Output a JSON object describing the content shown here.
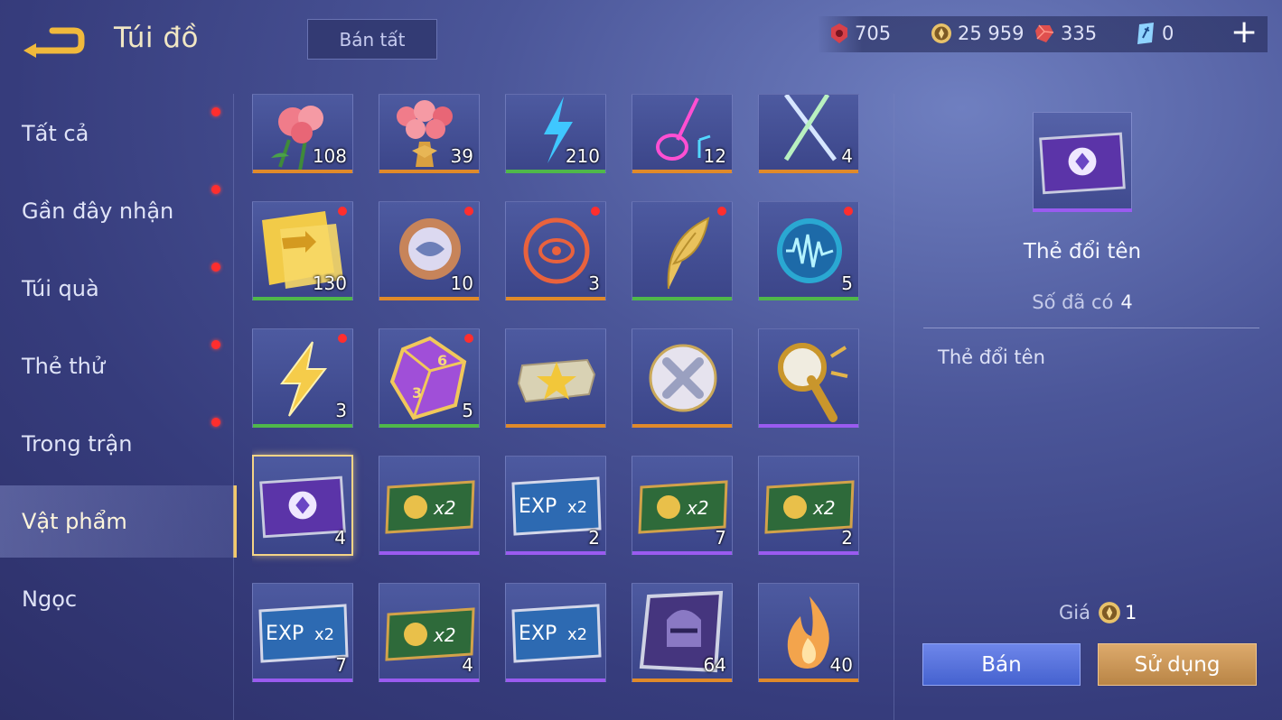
{
  "header": {
    "title": "Túi đồ",
    "sell_all_label": "Bán tất",
    "currencies": [
      {
        "icon": "honor-point-icon",
        "value": "705"
      },
      {
        "icon": "gold-coin-icon",
        "value": "25 959"
      },
      {
        "icon": "ruby-gem-icon",
        "value": "335"
      },
      {
        "icon": "voucher-icon",
        "value": "0"
      }
    ],
    "add_label": "+"
  },
  "sidebar": {
    "items": [
      {
        "label": "Tất cả",
        "dot": true,
        "active": false
      },
      {
        "label": "Gần đây nhận",
        "dot": true,
        "active": false
      },
      {
        "label": "Túi quà",
        "dot": true,
        "active": false
      },
      {
        "label": "Thẻ thử",
        "dot": true,
        "active": false
      },
      {
        "label": "Trong trận",
        "dot": true,
        "active": false
      },
      {
        "label": "Vật phẩm",
        "dot": false,
        "active": true
      },
      {
        "label": "Ngọc",
        "dot": false,
        "active": false
      }
    ]
  },
  "inventory": {
    "rows": [
      [
        {
          "icon": "rose-icon",
          "count": "108",
          "rarity": "orange",
          "new": false
        },
        {
          "icon": "rose-bouquet-icon",
          "count": "39",
          "rarity": "orange",
          "new": false
        },
        {
          "icon": "lightning-blue-icon",
          "count": "210",
          "rarity": "green",
          "new": false
        },
        {
          "icon": "neon-guitar-icon",
          "count": "12",
          "rarity": "orange",
          "new": false
        },
        {
          "icon": "crossed-swords-icon",
          "count": "4",
          "rarity": "orange",
          "new": false
        }
      ],
      [
        {
          "icon": "gold-ticket-icon",
          "count": "130",
          "rarity": "green",
          "new": true
        },
        {
          "icon": "bronze-orb-icon",
          "count": "10",
          "rarity": "orange",
          "new": true
        },
        {
          "icon": "dragon-emblem-icon",
          "count": "3",
          "rarity": "orange",
          "new": true
        },
        {
          "icon": "gold-leaf-icon",
          "count": "",
          "rarity": "green",
          "new": true
        },
        {
          "icon": "sound-wave-orb-icon",
          "count": "5",
          "rarity": "green",
          "new": true
        }
      ],
      [
        {
          "icon": "lightning-gold-icon",
          "count": "3",
          "rarity": "green",
          "new": true
        },
        {
          "icon": "dice-icon",
          "count": "5",
          "rarity": "green",
          "new": true
        },
        {
          "icon": "star-ticket-icon",
          "count": "",
          "rarity": "orange",
          "new": false
        },
        {
          "icon": "silver-cross-orb-icon",
          "count": "",
          "rarity": "orange",
          "new": false
        },
        {
          "icon": "trumpet-scepter-icon",
          "count": "",
          "rarity": "purple",
          "new": false
        }
      ],
      [
        {
          "icon": "rename-card-icon",
          "count": "4",
          "rarity": "purple",
          "new": false,
          "selected": true
        },
        {
          "icon": "gold-x2-card-icon",
          "count": "",
          "rarity": "purple",
          "new": false
        },
        {
          "icon": "exp-x2-card-icon",
          "count": "2",
          "rarity": "purple",
          "new": false
        },
        {
          "icon": "gold-x2-card-icon",
          "count": "7",
          "rarity": "purple",
          "new": false
        },
        {
          "icon": "gold-x2-card-icon",
          "count": "2",
          "rarity": "purple",
          "new": false
        }
      ],
      [
        {
          "icon": "exp-x2-card-icon",
          "count": "7",
          "rarity": "purple",
          "new": false
        },
        {
          "icon": "gold-x2-card-icon",
          "count": "4",
          "rarity": "purple",
          "new": false
        },
        {
          "icon": "exp-x2-card-icon",
          "count": "",
          "rarity": "purple",
          "new": false
        },
        {
          "icon": "helmet-card-icon",
          "count": "64",
          "rarity": "orange",
          "new": false
        },
        {
          "icon": "flame-icon",
          "count": "40",
          "rarity": "orange",
          "new": false
        }
      ]
    ],
    "card_texts": {
      "x2": "x2",
      "exp": "EXP"
    }
  },
  "detail": {
    "icon": "rename-card-icon",
    "name": "Thẻ đổi tên",
    "owned_label": "Số đã có",
    "owned_value": "4",
    "description": "Thẻ đổi tên",
    "price_label": "Giá",
    "price_value": "1",
    "sell_label": "Bán",
    "use_label": "Sử dụng"
  },
  "colors": {
    "rarity_orange": "#e08a2a",
    "rarity_green": "#4fb84a",
    "rarity_purple": "#9a5bf0",
    "new_dot": "#ff2e2e",
    "sell_button": "#4e6bd6",
    "use_button": "#c8924f",
    "selected_border": "#f4d487"
  }
}
